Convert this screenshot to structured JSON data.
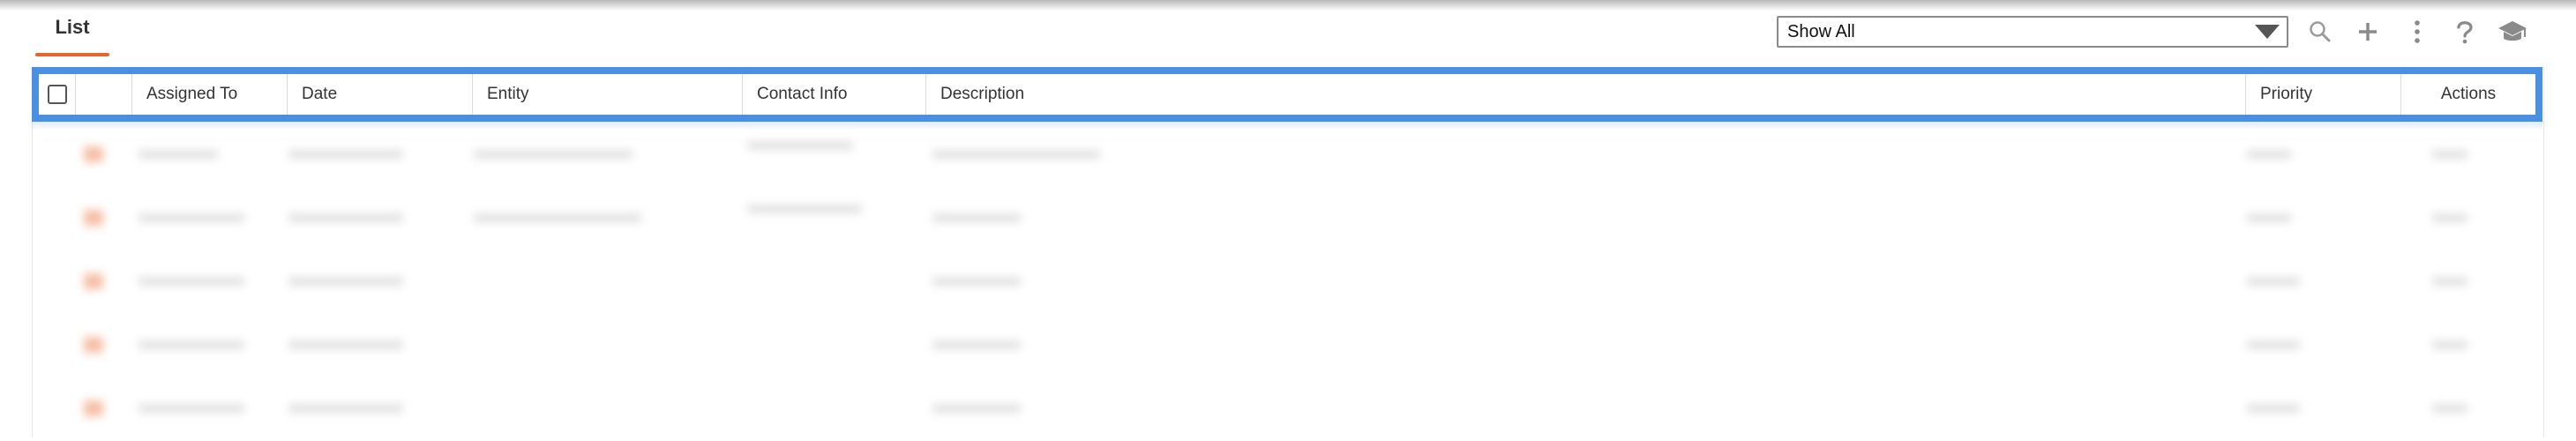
{
  "tabs": [
    {
      "label": "List",
      "active": true
    }
  ],
  "filter": {
    "selected": "Show All"
  },
  "toolbar": {
    "icons": [
      "search-icon",
      "plus-icon",
      "more-vertical-icon",
      "help-icon",
      "graduation-cap-icon"
    ]
  },
  "table": {
    "columns": [
      "",
      "",
      "Assigned To",
      "Date",
      "Entity",
      "Contact Info",
      "Description",
      "Priority",
      "Actions"
    ],
    "visible_rows": 5
  },
  "colors": {
    "accent": "#e8662d",
    "highlight": "#4a90e2"
  }
}
